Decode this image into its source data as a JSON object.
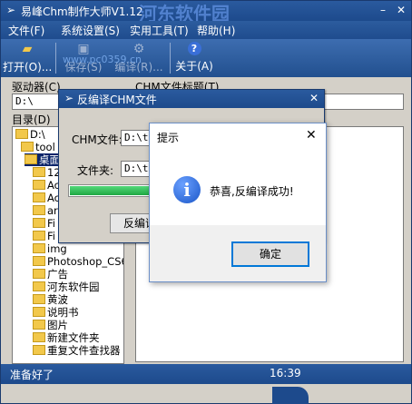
{
  "app": {
    "title": "易峰Chm制作大师V1.12",
    "watermark": "河东软件园",
    "watermark_url": "www.pc0359.cn"
  },
  "menu": [
    "文件(F)",
    "系统设置(S)",
    "实用工具(T)",
    "帮助(H)"
  ],
  "toolbar": [
    {
      "label": "打开(O)...",
      "icon": "folder-open-icon",
      "enabled": true
    },
    {
      "label": "保存(S)",
      "icon": "save-icon",
      "enabled": false
    },
    {
      "label": "编译(R)...",
      "icon": "compile-icon",
      "enabled": false
    },
    {
      "label": "关于(A)",
      "icon": "help-icon",
      "enabled": true
    }
  ],
  "left": {
    "drive_label": "驱动器(C)",
    "drive_value": "D:\\",
    "dir_label": "目录(D)",
    "tree": [
      "D:\\",
      "tool",
      "桌面",
      "12",
      "Ac",
      "Ac",
      "ar",
      "Fi",
      "Fi",
      "img",
      "Photoshop_CS6_",
      "广告",
      "河东软件园",
      "黄波",
      "说明书",
      "图片",
      "新建文件夹",
      "重复文件查找器"
    ]
  },
  "right": {
    "title_label": "CHM文件标题(T)"
  },
  "status": {
    "text": "准备好了",
    "time": "16:39"
  },
  "decompile_dialog": {
    "title": "反编译CHM文件",
    "chm_label": "CHM文件:",
    "chm_value": "D:\\to",
    "folder_label": "文件夹:",
    "folder_value": "D:\\to",
    "progress": 1.0,
    "button_label": "反编译"
  },
  "message_box": {
    "title": "提示",
    "message": "恭喜,反编译成功!",
    "ok_label": "确定"
  },
  "colors": {
    "title_blue": "#1d4a8c",
    "progress_green": "#22b84a",
    "ok_border": "#0078d7"
  }
}
